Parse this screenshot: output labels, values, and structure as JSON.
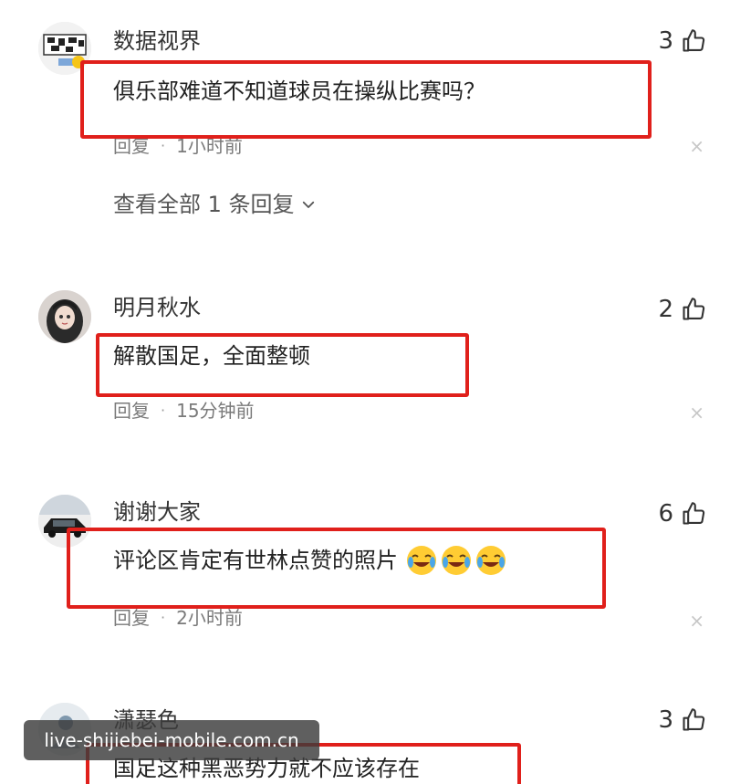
{
  "comments": [
    {
      "username": "数据视界",
      "likes": "3",
      "text": "俱乐部难道不知道球员在操纵比赛吗？",
      "reply_label": "回复",
      "time": "1小时前",
      "view_replies": "查看全部 1 条回复"
    },
    {
      "username": "明月秋水",
      "likes": "2",
      "text": "解散国足，全面整顿",
      "reply_label": "回复",
      "time": "15分钟前"
    },
    {
      "username": "谢谢大家",
      "likes": "6",
      "text": "评论区肯定有世林点赞的照片",
      "emoji_icon": "crying-laughing-emoji",
      "reply_label": "回复",
      "time": "2小时前"
    },
    {
      "username": "潇瑟色",
      "likes": "3",
      "text": "国足这种黑恶势力就不应该存在"
    }
  ],
  "highlight_color": "#e0201b",
  "watermark": "live-shijiebei-mobile.com.cn",
  "icons": {
    "like": "thumbs-up-icon",
    "close": "close-icon",
    "expand": "chevron-down-icon"
  },
  "close_glyph": "×"
}
